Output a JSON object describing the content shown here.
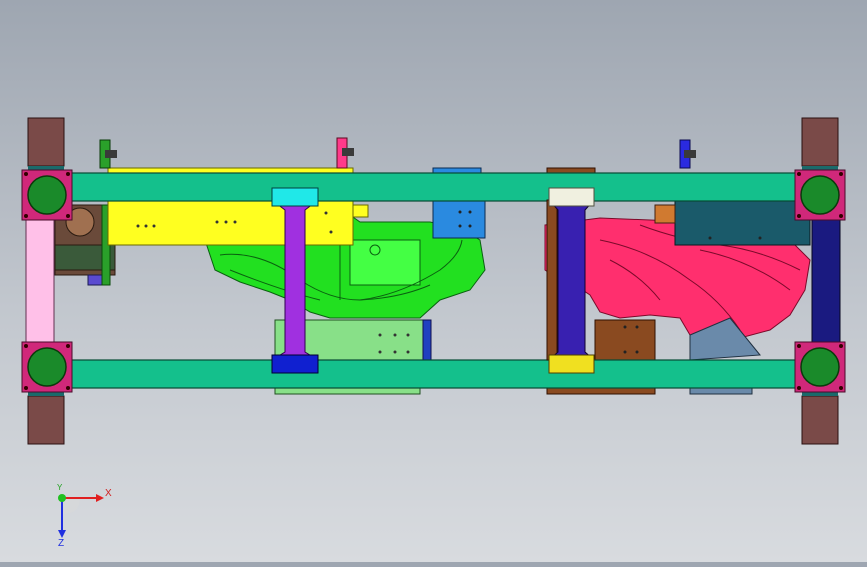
{
  "viewport": {
    "background_top": "#9ea6b1",
    "background_bottom": "#d8dbdf"
  },
  "triad": {
    "x_label": "X",
    "y_label": "Y",
    "z_label": "Z",
    "x_color": "#e02020",
    "y_color": "#20c020",
    "z_color": "#2030e0"
  },
  "colors": {
    "frame_rail": "#14c08c",
    "wheel_block": "#7a4a48",
    "corner_plate": "#d0287a",
    "wheel_hub": "#1a8a2a",
    "yellow_bracket": "#ffff20",
    "green_part": "#22e020",
    "red_part": "#ff2f6e",
    "cross_purple": "#a030e0",
    "cross_navy": "#3820b0",
    "left_strut": "#ffc0e8",
    "right_strut": "#1a1a80",
    "blue_block": "#2a8ae0",
    "teal_block": "#1a5a6a",
    "brown_block": "#8a4a20",
    "light_green_plate": "#88e088",
    "steel_plate": "#6a8aaa"
  }
}
